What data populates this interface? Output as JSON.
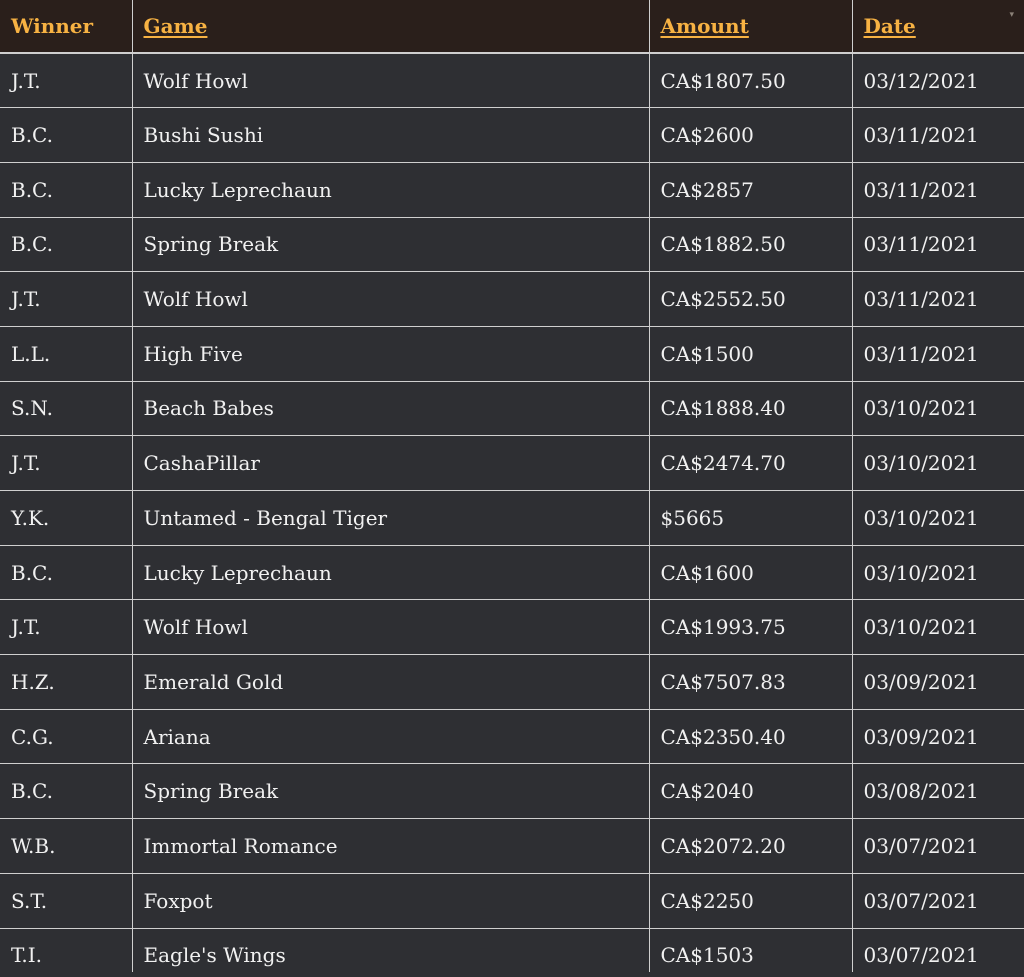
{
  "table": {
    "headers": {
      "winner": "Winner",
      "game": "Game",
      "amount": "Amount",
      "date": "Date"
    },
    "sort_indicator": "▾",
    "rows": [
      {
        "winner": "J.T.",
        "game": "Wolf Howl",
        "amount": "CA$1807.50",
        "date": "03/12/2021"
      },
      {
        "winner": "B.C.",
        "game": "Bushi Sushi",
        "amount": "CA$2600",
        "date": "03/11/2021"
      },
      {
        "winner": "B.C.",
        "game": "Lucky Leprechaun",
        "amount": "CA$2857",
        "date": "03/11/2021"
      },
      {
        "winner": "B.C.",
        "game": "Spring Break",
        "amount": "CA$1882.50",
        "date": "03/11/2021"
      },
      {
        "winner": "J.T.",
        "game": "Wolf Howl",
        "amount": "CA$2552.50",
        "date": "03/11/2021"
      },
      {
        "winner": "L.L.",
        "game": "High Five",
        "amount": "CA$1500",
        "date": "03/11/2021"
      },
      {
        "winner": "S.N.",
        "game": "Beach Babes",
        "amount": "CA$1888.40",
        "date": "03/10/2021"
      },
      {
        "winner": "J.T.",
        "game": "CashaPillar",
        "amount": "CA$2474.70",
        "date": "03/10/2021"
      },
      {
        "winner": "Y.K.",
        "game": "Untamed - Bengal Tiger",
        "amount": "$5665",
        "date": "03/10/2021"
      },
      {
        "winner": "B.C.",
        "game": "Lucky Leprechaun",
        "amount": "CA$1600",
        "date": "03/10/2021"
      },
      {
        "winner": "J.T.",
        "game": "Wolf Howl",
        "amount": "CA$1993.75",
        "date": "03/10/2021"
      },
      {
        "winner": "H.Z.",
        "game": "Emerald Gold",
        "amount": "CA$7507.83",
        "date": "03/09/2021"
      },
      {
        "winner": "C.G.",
        "game": "Ariana",
        "amount": "CA$2350.40",
        "date": "03/09/2021"
      },
      {
        "winner": "B.C.",
        "game": "Spring Break",
        "amount": "CA$2040",
        "date": "03/08/2021"
      },
      {
        "winner": "W.B.",
        "game": "Immortal Romance",
        "amount": "CA$2072.20",
        "date": "03/07/2021"
      },
      {
        "winner": "S.T.",
        "game": "Foxpot",
        "amount": "CA$2250",
        "date": "03/07/2021"
      },
      {
        "winner": "T.I.",
        "game": "Eagle's Wings",
        "amount": "CA$1503",
        "date": "03/07/2021"
      }
    ]
  },
  "colors": {
    "header_bg": "#2a1f1b",
    "header_text": "#f7b243",
    "body_bg": "#2e2f33",
    "cell_text": "#f1f1f1",
    "grid_line": "#cfcfcf"
  }
}
